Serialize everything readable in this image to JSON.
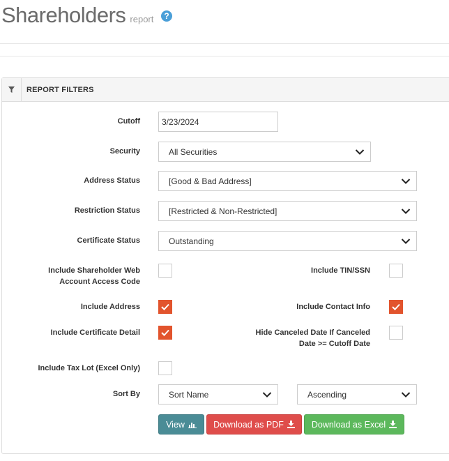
{
  "page": {
    "title": "Shareholders",
    "subtitle": "report",
    "help_icon": "?"
  },
  "panel": {
    "title": "REPORT FILTERS",
    "icon": "filter-icon"
  },
  "fields": {
    "cutoff": {
      "label": "Cutoff",
      "value": "3/23/2024"
    },
    "security": {
      "label": "Security",
      "value": "All Securities"
    },
    "address_status": {
      "label": "Address Status",
      "value": "[Good & Bad Address]"
    },
    "restriction_status": {
      "label": "Restriction Status",
      "value": "[Restricted & Non-Restricted]"
    },
    "certificate_status": {
      "label": "Certificate Status",
      "value": "Outstanding"
    },
    "sort_by": {
      "label": "Sort By",
      "value": "Sort Name",
      "order": "Ascending"
    }
  },
  "checkboxes": {
    "web_access": {
      "label_line1": "Include Shareholder Web",
      "label_line2": "Account Access Code",
      "checked": false
    },
    "tin_ssn": {
      "label": "Include TIN/SSN",
      "checked": false
    },
    "address": {
      "label": "Include Address",
      "checked": true
    },
    "contact_info": {
      "label": "Include Contact Info",
      "checked": true
    },
    "certificate_detail": {
      "label": "Include Certificate Detail",
      "checked": true
    },
    "hide_canceled": {
      "label_line1": "Hide Canceled Date If Canceled",
      "label_line2": "Date >= Cutoff Date",
      "checked": false
    },
    "tax_lot": {
      "label": "Include Tax Lot (Excel Only)",
      "checked": false
    }
  },
  "buttons": {
    "view": "View",
    "pdf": "Download as PDF",
    "excel": "Download as Excel"
  },
  "colors": {
    "checkbox_checked": "#e2542d",
    "help": "#4a9fd8",
    "view": "#4a8c96",
    "pdf": "#df4d4b",
    "excel": "#5cb85c"
  }
}
